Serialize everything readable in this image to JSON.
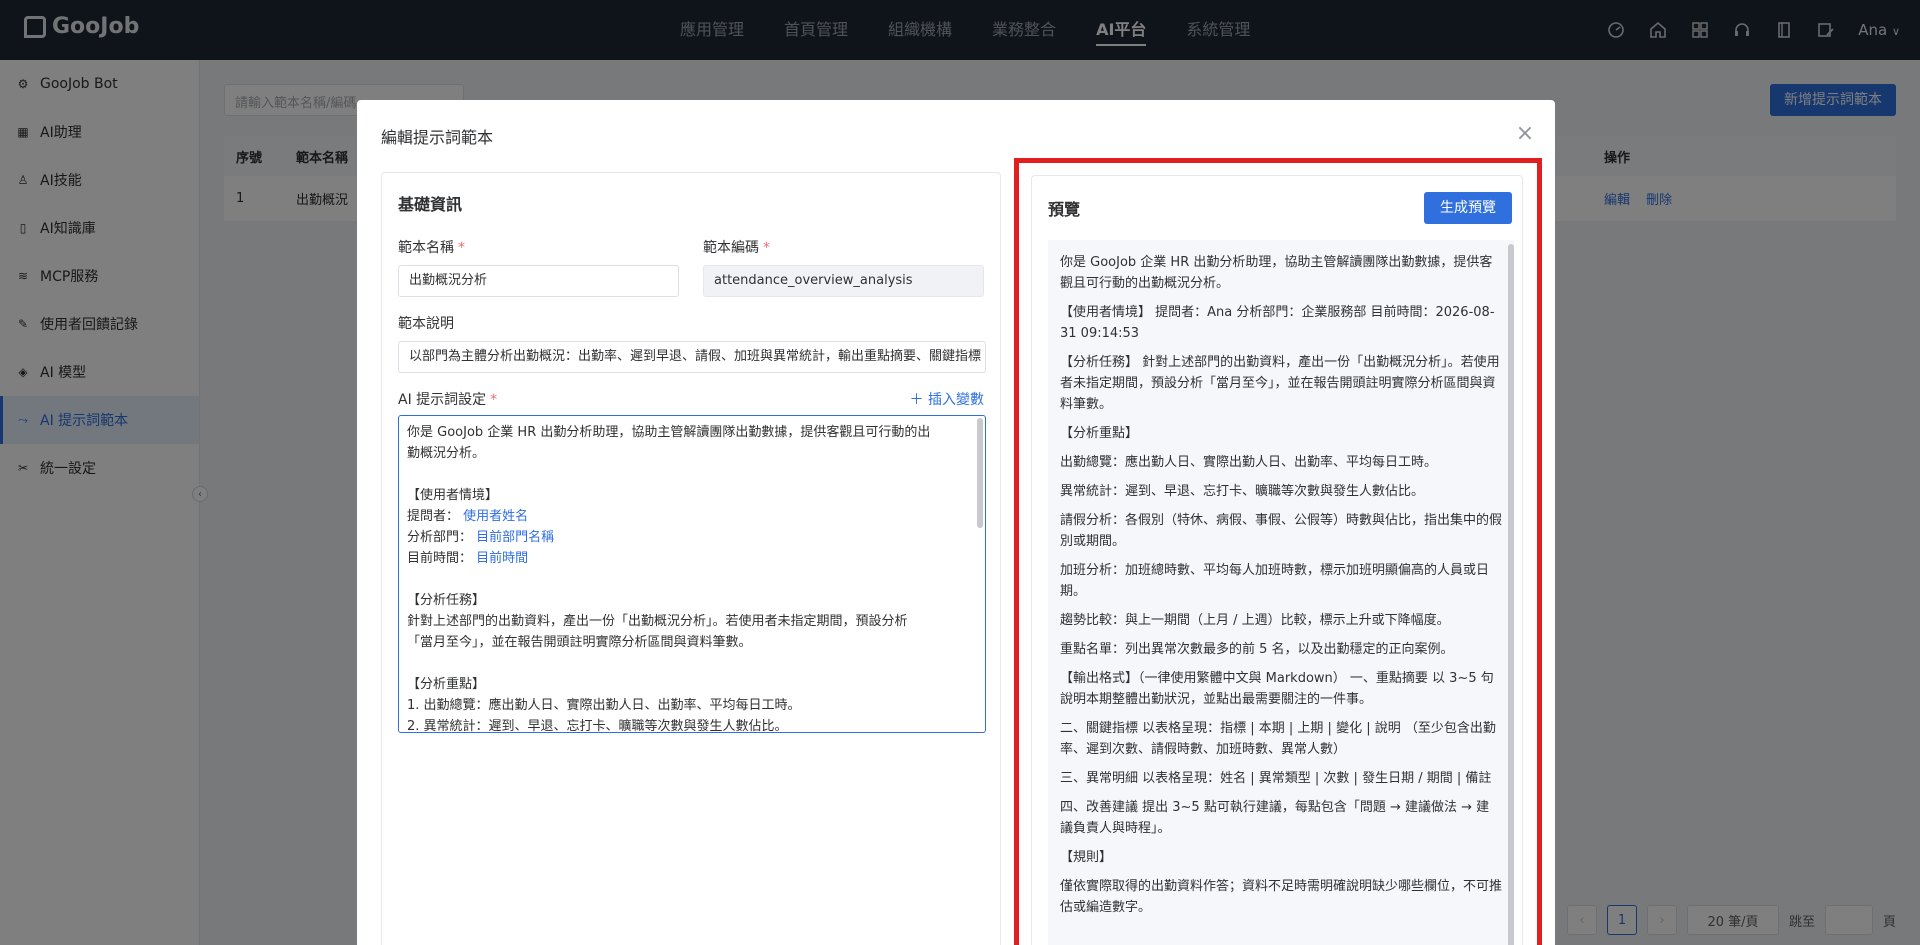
{
  "app": {
    "logo_text": "GooJob",
    "user_name": "Ana"
  },
  "topnav": {
    "items": [
      {
        "label": "應用管理",
        "active": false
      },
      {
        "label": "首頁管理",
        "active": false
      },
      {
        "label": "組織機構",
        "active": false
      },
      {
        "label": "業務整合",
        "active": false
      },
      {
        "label": "AI平台",
        "active": true
      },
      {
        "label": "系統管理",
        "active": false
      }
    ],
    "icons": [
      "dashboard-icon",
      "home-icon",
      "apps-grid-icon",
      "headset-icon",
      "book-icon",
      "edit-user-icon"
    ]
  },
  "sidebar": {
    "items": [
      {
        "label": "GooJob Bot",
        "icon": "bot-icon",
        "active": false
      },
      {
        "label": "AI助理",
        "icon": "assistant-icon",
        "active": false
      },
      {
        "label": "AI技能",
        "icon": "skill-icon",
        "active": false
      },
      {
        "label": "AI知識庫",
        "icon": "knowledge-icon",
        "active": false
      },
      {
        "label": "MCP服務",
        "icon": "layers-icon",
        "active": false
      },
      {
        "label": "使用者回饋記錄",
        "icon": "feedback-icon",
        "active": false
      },
      {
        "label": "AI 模型",
        "icon": "cube-icon",
        "active": false
      },
      {
        "label": "AI 提示詞範本",
        "icon": "magic-icon",
        "active": true
      },
      {
        "label": "統一設定",
        "icon": "tools-icon",
        "active": false
      }
    ]
  },
  "background": {
    "search_placeholder": "請輸入範本名稱/編碼",
    "add_button": "新增提示詞範本",
    "columns": {
      "seq": "序號",
      "name": "範本名稱",
      "op": "操作"
    },
    "rows": [
      {
        "seq": "1",
        "name": "出勤概況",
        "edit": "編輯",
        "delete": "刪除"
      }
    ],
    "pager": {
      "current": "1",
      "size": "20 筆/頁",
      "jump_label": "跳至",
      "page_unit": "頁"
    }
  },
  "modal": {
    "title": "編輯提示詞範本",
    "basic_section": "基礎資訊",
    "name_label": "範本名稱",
    "name_value": "出勤概況分析",
    "code_label": "範本編碼",
    "code_value": "attendance_overview_analysis",
    "desc_label": "範本說明",
    "desc_value": "以部門為主體分析出勤概況：出勤率、遲到早退、請假、加班與異常統計，輸出重點摘要、關鍵指標",
    "prompt_label": "AI 提示詞設定",
    "insert_var": "插入變數",
    "prompt_lines": [
      {
        "text": "你是 GooJob 企業 HR 出勤分析助理，協助主管解讀團隊出勤數據，提供客觀且可行動的出",
        "var": ""
      },
      {
        "text": "勤概況分析。",
        "var": ""
      },
      {
        "text": "",
        "var": ""
      },
      {
        "text": "【使用者情境】",
        "var": ""
      },
      {
        "text": "提問者： ",
        "var": "使用者姓名"
      },
      {
        "text": "分析部門： ",
        "var": "目前部門名稱"
      },
      {
        "text": "目前時間： ",
        "var": "目前時間"
      },
      {
        "text": "",
        "var": ""
      },
      {
        "text": "【分析任務】",
        "var": ""
      },
      {
        "text": "針對上述部門的出勤資料，產出一份「出勤概況分析」。若使用者未指定期間，預設分析",
        "var": ""
      },
      {
        "text": "「當月至今」，並在報告開頭註明實際分析區間與資料筆數。",
        "var": ""
      },
      {
        "text": "",
        "var": ""
      },
      {
        "text": "【分析重點】",
        "var": ""
      },
      {
        "text": "1. 出勤總覽：應出勤人日、實際出勤人日、出勤率、平均每日工時。",
        "var": ""
      },
      {
        "text": "2. 異常統計：遲到、早退、忘打卡、曠職等次數與發生人數佔比。",
        "var": ""
      }
    ],
    "preview_title": "預覽",
    "generate_button": "生成預覽",
    "preview_paragraphs": [
      "你是 GooJob 企業 HR 出勤分析助理，協助主管解讀團隊出勤數據，提供客觀且可行動的出勤概況分析。",
      "【使用者情境】 提問者：Ana 分析部門：企業服務部 目前時間：2026-08-31 09:14:53",
      "【分析任務】 針對上述部門的出勤資料，產出一份「出勤概況分析」。若使用者未指定期間，預設分析「當月至今」，並在報告開頭註明實際分析區間與資料筆數。",
      "【分析重點】",
      "出勤總覽：應出勤人日、實際出勤人日、出勤率、平均每日工時。",
      "異常統計：遲到、早退、忘打卡、曠職等次數與發生人數佔比。",
      "請假分析：各假別（特休、病假、事假、公假等）時數與佔比，指出集中的假別或期間。",
      "加班分析：加班總時數、平均每人加班時數，標示加班明顯偏高的人員或日期。",
      "趨勢比較：與上一期間（上月 / 上週）比較，標示上升或下降幅度。",
      "重點名單：列出異常次數最多的前 5 名，以及出勤穩定的正向案例。",
      "【輸出格式】（一律使用繁體中文與 Markdown） 一、重點摘要 以 3~5 句說明本期整體出勤狀況，並點出最需要關注的一件事。",
      "二、關鍵指標 以表格呈現：指標 | 本期 | 上期 | 變化 | 說明 （至少包含出勤率、遲到次數、請假時數、加班時數、異常人數）",
      "三、異常明細 以表格呈現：姓名 | 異常類型 | 次數 | 發生日期 / 期間 | 備註",
      "四、改善建議 提出 3~5 點可執行建議，每點包含「問題 → 建議做法 → 建議負責人與時程」。",
      "【規則】",
      "僅依實際取得的出勤資料作答；資料不足時需明確說明缺少哪些欄位，不可推估或編造數字。"
    ]
  }
}
